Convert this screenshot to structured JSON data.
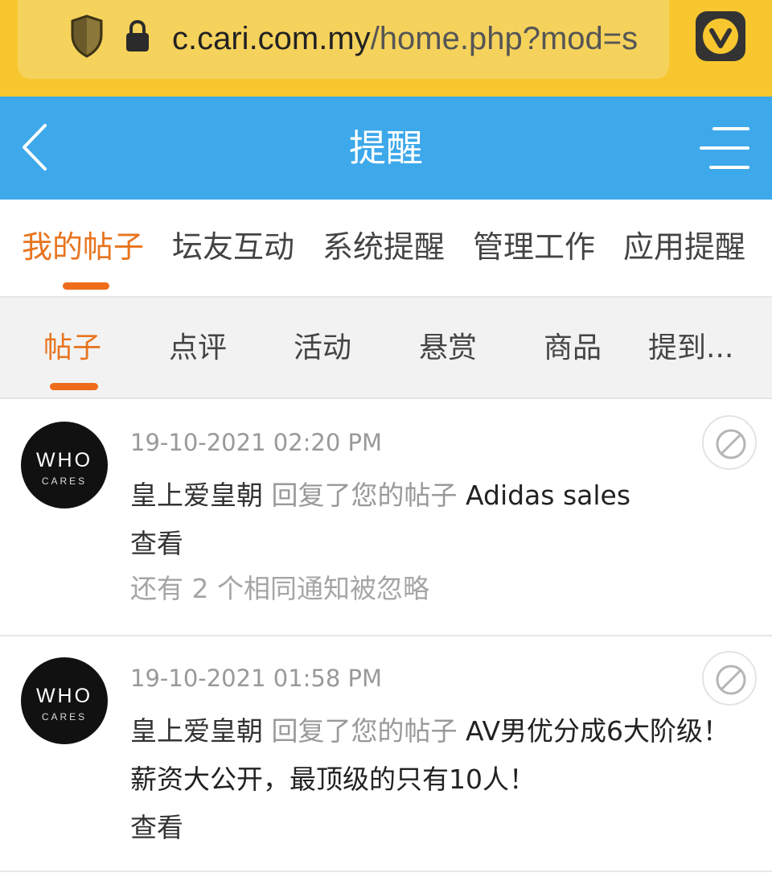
{
  "browser": {
    "url_host": "c.cari.com.my",
    "url_path": "/home.php?mod=s",
    "icons": {
      "shield": "shield-icon",
      "lock": "lock-icon",
      "menu": "vivaldi-icon"
    }
  },
  "header": {
    "title": "提醒",
    "back_icon": "chevron-left-icon",
    "menu_icon": "hamburger-menu-icon",
    "color": "#3da8ea"
  },
  "primary_tabs": [
    {
      "label": "我的帖子",
      "active": true
    },
    {
      "label": "坛友互动",
      "active": false
    },
    {
      "label": "系统提醒",
      "active": false
    },
    {
      "label": "管理工作",
      "active": false
    },
    {
      "label": "应用提醒",
      "active": false
    }
  ],
  "secondary_tabs": [
    {
      "label": "帖子",
      "active": true
    },
    {
      "label": "点评",
      "active": false
    },
    {
      "label": "活动",
      "active": false
    },
    {
      "label": "悬赏",
      "active": false
    },
    {
      "label": "商品",
      "active": false
    },
    {
      "label": "提到...",
      "active": false
    }
  ],
  "accent_color": "#ef6c1a",
  "notifications": [
    {
      "avatar_top": "WHO",
      "avatar_bottom": "CARES",
      "time": "19-10-2021 02:20 PM",
      "actor": "皇上爱皇朝",
      "action": "回复了您的帖子",
      "post_title": "Adidas sales",
      "view_label": "查看",
      "extra": "还有 2 个相同通知被忽略"
    },
    {
      "avatar_top": "WHO",
      "avatar_bottom": "CARES",
      "time": "19-10-2021 01:58 PM",
      "actor": "皇上爱皇朝",
      "action": "回复了您的帖子",
      "post_title": "AV男优分成6大阶级！　薪资大公开，最顶级的只有10人！",
      "view_label": "查看"
    }
  ]
}
